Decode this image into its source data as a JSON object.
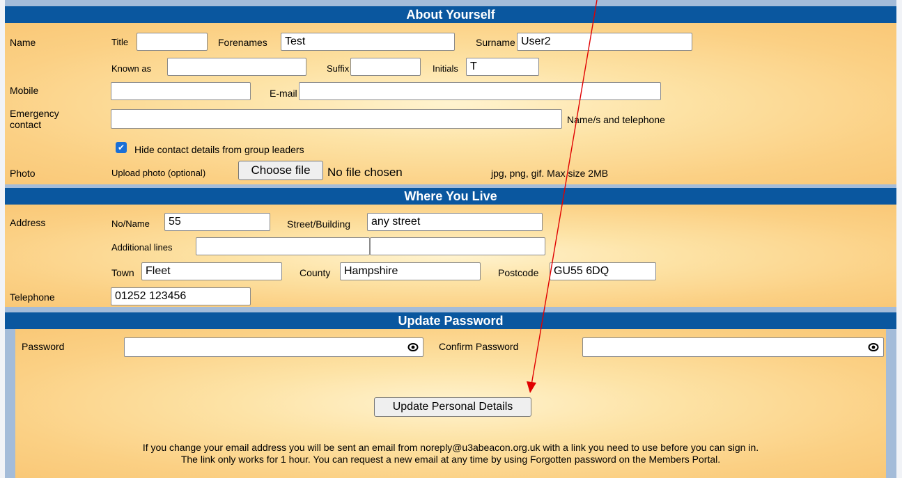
{
  "about": {
    "header": "About Yourself",
    "name_label": "Name",
    "title_label": "Title",
    "title_value": "",
    "forenames_label": "Forenames",
    "forenames_value": "Test",
    "surname_label": "Surname",
    "surname_value": "User2",
    "known_as_label": "Known as",
    "known_as_value": "",
    "suffix_label": "Suffix",
    "suffix_value": "",
    "initials_label": "Initials",
    "initials_value": "T",
    "mobile_label": "Mobile",
    "mobile_value": "",
    "email_label": "E-mail",
    "email_value": "",
    "emergency_label": "Emergency contact",
    "emergency_value": "",
    "emergency_hint": "Name/s and telephone",
    "hide_contact_label": "Hide contact details from group leaders",
    "hide_contact_checked": true,
    "photo_label": "Photo",
    "upload_label": "Upload photo (optional)",
    "choose_file_label": "Choose file",
    "no_file_label": "No file chosen",
    "photo_hint": "jpg, png, gif. Max size 2MB"
  },
  "where": {
    "header": "Where You Live",
    "address_label": "Address",
    "noname_label": "No/Name",
    "noname_value": "55",
    "street_label": "Street/Building",
    "street_value": "any street",
    "additional_label": "Additional lines",
    "additional1_value": "",
    "additional2_value": "",
    "town_label": "Town",
    "town_value": "Fleet",
    "county_label": "County",
    "county_value": "Hampshire",
    "postcode_label": "Postcode",
    "postcode_value": "GU55 6DQ",
    "telephone_label": "Telephone",
    "telephone_value": "01252 123456"
  },
  "password": {
    "header": "Update Password",
    "password_label": "Password",
    "password_value": "",
    "confirm_label": "Confirm Password",
    "confirm_value": ""
  },
  "actions": {
    "update_label": "Update Personal Details"
  },
  "footer": {
    "line1": "If you change your email address you will be sent an email from noreply@u3abeacon.org.uk with a link you need to use before you can sign in.",
    "line2": "The link only works for 1 hour. You can request a new email at any time by using Forgotten password on the Members Portal."
  },
  "colors": {
    "header_bg": "#0a579f",
    "annotation_arrow": "#e00000",
    "checkbox": "#1a6fd6"
  },
  "icons": {
    "eye": "eye-icon"
  }
}
